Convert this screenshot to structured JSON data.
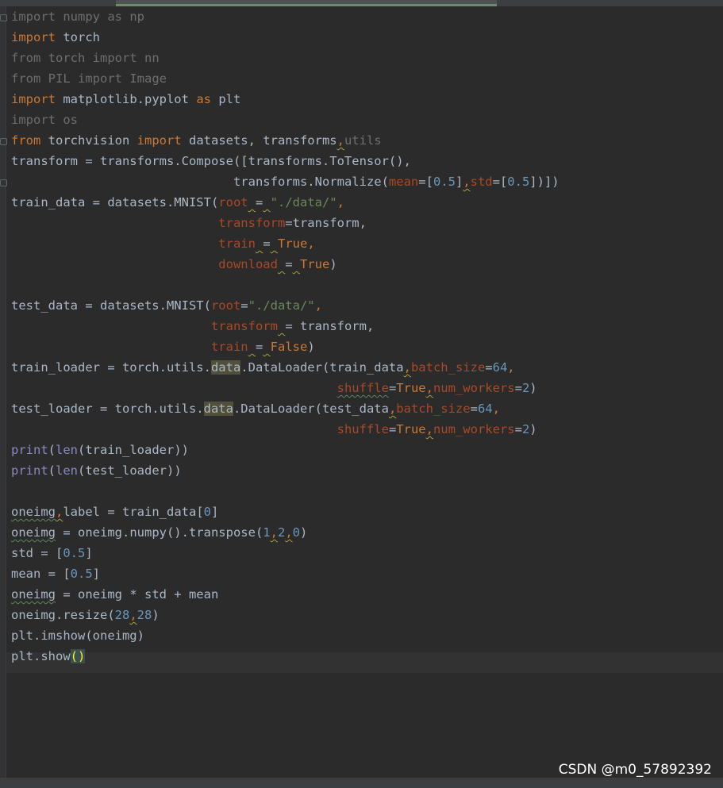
{
  "watermark": "CSDN @m0_57892392",
  "colors": {
    "background": "#2b2b2b",
    "keyword": "#cc7832",
    "string": "#6a8759",
    "number": "#6897bb",
    "param": "#aa4926",
    "builtin": "#8888c6",
    "text": "#a9b7c6"
  },
  "code": {
    "l1": {
      "a": "import",
      "b": " numpy ",
      "c": "as",
      "d": " np"
    },
    "l2": {
      "a": "import",
      "b": " torch"
    },
    "l3": {
      "a": "from",
      "b": " torch ",
      "c": "import",
      "d": " nn"
    },
    "l4": {
      "a": "from",
      "b": " PIL ",
      "c": "import",
      "d": " Image"
    },
    "l5": {
      "a": "import",
      "b": " matplotlib.pyplot ",
      "c": "as",
      "d": " plt"
    },
    "l6": {
      "a": "import",
      "b": " os"
    },
    "l7": {
      "a": "from",
      "b": " torchvision ",
      "c": "import",
      "d": " datasets, transforms",
      "e": ",",
      "f": "utils"
    },
    "l8": {
      "a": "transform = transforms.Compose([transforms.ToTensor(),"
    },
    "l9": {
      "indent": "                              ",
      "a": "transforms.Normalize(",
      "b": "mean",
      "c": "=[",
      "d": "0.5",
      "e": "]",
      "f": ",",
      "g": "std",
      "h": "=[",
      "i": "0.5",
      "j": "])])"
    },
    "l10": {
      "a": "train_data = datasets.MNIST(",
      "b": "root",
      "c": " ",
      "d": "=",
      "e": " ",
      "f": "\"./data/\"",
      "g": ","
    },
    "l11": {
      "indent": "                            ",
      "a": "transform",
      "b": "=transform,"
    },
    "l12": {
      "indent": "                            ",
      "a": "train",
      "b": " ",
      "c": "=",
      "d": " ",
      "e": "True",
      "f": ","
    },
    "l13": {
      "indent": "                            ",
      "a": "download",
      "b": " ",
      "c": "=",
      "d": " ",
      "e": "True",
      "f": ")"
    },
    "l15": {
      "a": "test_data = datasets.MNIST(",
      "b": "root",
      "c": "=",
      "d": "\"./data/\"",
      "e": ","
    },
    "l16": {
      "indent": "                           ",
      "a": "transform",
      "b": " ",
      "c": "=",
      "d": " transform,"
    },
    "l17": {
      "indent": "                           ",
      "a": "train",
      "b": " ",
      "c": "=",
      "d": " ",
      "e": "False",
      "f": ")"
    },
    "l18": {
      "a": "train_loader = torch.utils.",
      "b": "data",
      "c": ".DataLoader(train_data",
      "d": ",",
      "e": "batch_size",
      "f": "=",
      "g": "64",
      "h": ","
    },
    "l19": {
      "indent": "                                            ",
      "a": "shuffle",
      "b": "=",
      "c": "True",
      "d": ",",
      "e": "num_workers",
      "f": "=",
      "g": "2",
      "h": ")"
    },
    "l20": {
      "a": "test_loader = torch.utils.",
      "b": "data",
      "c": ".DataLoader(test_data",
      "d": ",",
      "e": "batch_size",
      "f": "=",
      "g": "64",
      "h": ","
    },
    "l21": {
      "indent": "                                            ",
      "a": "shuffle",
      "b": "=",
      "c": "True",
      "d": ",",
      "e": "num_workers",
      "f": "=",
      "g": "2",
      "h": ")"
    },
    "l22": {
      "a": "print",
      "b": "(",
      "c": "len",
      "d": "(train_loader))"
    },
    "l23": {
      "a": "print",
      "b": "(",
      "c": "len",
      "d": "(test_loader))"
    },
    "l25": {
      "a": "oneimg",
      "b": ",",
      "c": "label = train_data[",
      "d": "0",
      "e": "]"
    },
    "l26": {
      "a": "oneimg",
      "b": " = oneimg.numpy().transpose(",
      "c": "1",
      "d": ",",
      "e": "2",
      "f": ",",
      "g": "0",
      "h": ")"
    },
    "l27": {
      "a": "std = [",
      "b": "0.5",
      "c": "]"
    },
    "l28": {
      "a": "mean = [",
      "b": "0.5",
      "c": "]"
    },
    "l29": {
      "a": "oneimg",
      "b": " = oneimg * std + mean"
    },
    "l30": {
      "a": "oneimg.resize(",
      "b": "28",
      "c": ",",
      "d": "28",
      "e": ")"
    },
    "l31": {
      "a": "plt.imshow(oneimg)"
    },
    "l32": {
      "a": "plt.show",
      "b": "()"
    }
  }
}
